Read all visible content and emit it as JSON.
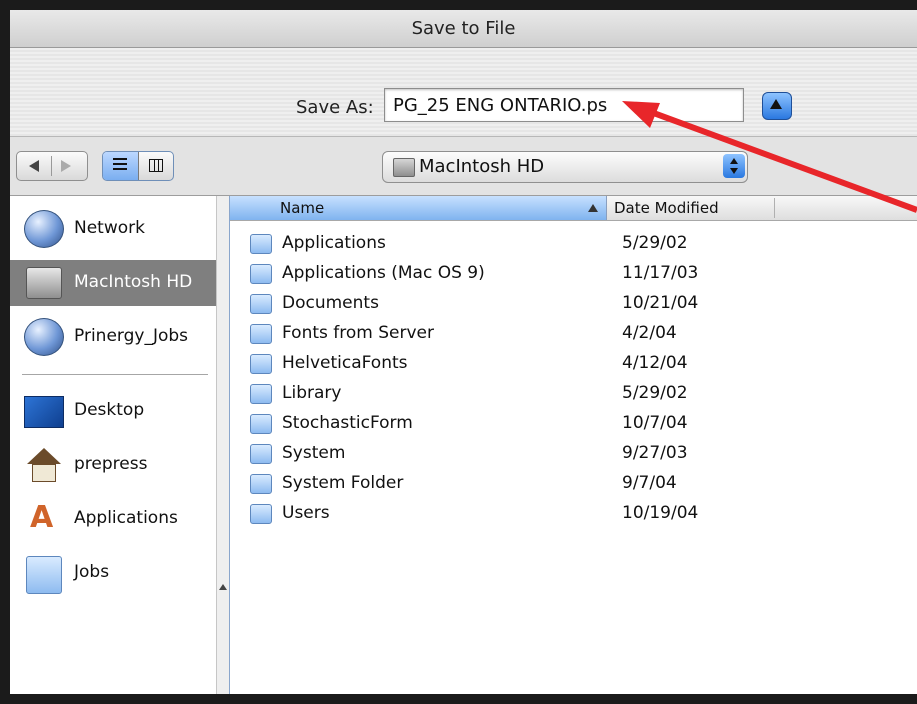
{
  "window": {
    "title": "Save to File"
  },
  "save_as": {
    "label": "Save As:",
    "value": "PG_25 ENG ONTARIO.ps"
  },
  "location": {
    "selected": "MacIntosh HD"
  },
  "sidebar": {
    "items": [
      {
        "label": "Network",
        "icon": "network-globe-icon"
      },
      {
        "label": "MacIntosh HD",
        "icon": "hard-drive-icon",
        "selected": true
      },
      {
        "label": "Prinergy_Jobs",
        "icon": "network-volume-icon"
      },
      {
        "label": "Desktop",
        "icon": "desktop-icon"
      },
      {
        "label": "prepress",
        "icon": "home-icon"
      },
      {
        "label": "Applications",
        "icon": "applications-icon"
      },
      {
        "label": "Jobs",
        "icon": "folder-icon"
      }
    ]
  },
  "file_list": {
    "columns": {
      "name": "Name",
      "date": "Date Modified"
    },
    "rows": [
      {
        "name": "Applications",
        "date": "5/29/02",
        "icon": "applications-folder-icon"
      },
      {
        "name": "Applications (Mac OS 9)",
        "date": "11/17/03",
        "icon": "folder-icon"
      },
      {
        "name": "Documents",
        "date": "10/21/04",
        "icon": "folder-icon"
      },
      {
        "name": "Fonts from Server",
        "date": "4/2/04",
        "icon": "folder-icon"
      },
      {
        "name": "HelveticaFonts",
        "date": "4/12/04",
        "icon": "folder-icon"
      },
      {
        "name": "Library",
        "date": "5/29/02",
        "icon": "library-folder-icon"
      },
      {
        "name": "StochasticForm",
        "date": "10/7/04",
        "icon": "folder-icon"
      },
      {
        "name": "System",
        "date": "9/27/03",
        "icon": "system-folder-icon"
      },
      {
        "name": "System Folder",
        "date": "9/7/04",
        "icon": "system-folder-icon"
      },
      {
        "name": "Users",
        "date": "10/19/04",
        "icon": "users-folder-icon"
      }
    ]
  },
  "colors": {
    "annotation_arrow": "#e8262a",
    "selection_gray": "#7f7f7f",
    "aqua_blue": "#2a78e0"
  }
}
